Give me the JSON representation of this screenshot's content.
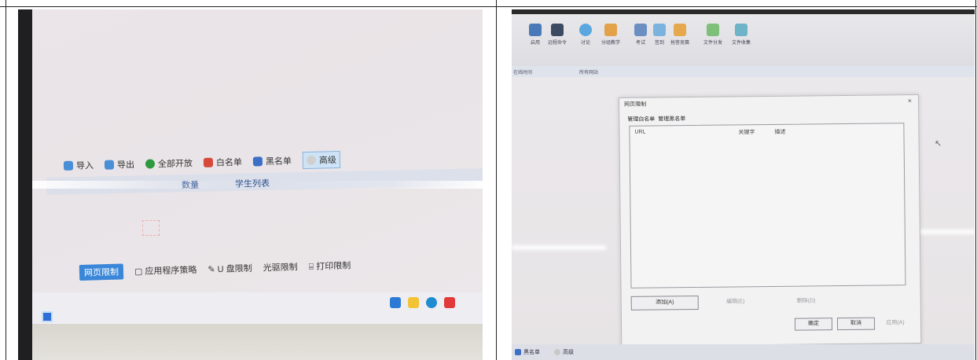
{
  "left": {
    "toolbar": [
      {
        "label": "导入",
        "icon": "import-icon",
        "color": "#4a8fd6"
      },
      {
        "label": "导出",
        "icon": "export-icon",
        "color": "#4a8fd6"
      },
      {
        "label": "全部开放",
        "icon": "open-all-icon",
        "color": "#2e9a3e"
      },
      {
        "label": "白名单",
        "icon": "whitelist-icon",
        "color": "#d6493a"
      },
      {
        "label": "黑名单",
        "icon": "blacklist-icon",
        "color": "#3d6fc6"
      },
      {
        "label": "高级",
        "icon": "advanced-icon",
        "color": "#888888"
      }
    ],
    "tabs": [
      "数量",
      "学生列表"
    ],
    "bottom_tabs": [
      "网页限制",
      "应用程序策略",
      "U 盘限制",
      "光驱限制",
      "打印限制"
    ],
    "accent": "#3a86d8"
  },
  "right": {
    "toolbar": [
      "启用",
      "远程命令",
      "讨论",
      "分组教学",
      "考试",
      "签到",
      "抢答竞赛",
      "文件分发",
      "文件收集"
    ],
    "subtabs": [
      "在线时间",
      "所有网站"
    ],
    "dialog": {
      "title": "网页限制",
      "close": "×",
      "tabs": [
        "管理白名单",
        "管理黑名单"
      ],
      "columns": [
        "URL",
        "关键字",
        "描述"
      ],
      "add": "添加(A)",
      "edit": "编辑(E)",
      "delete": "删除(D)",
      "ok": "确定",
      "cancel": "取消",
      "apply": "应用(A)"
    },
    "footer": [
      "黑名单",
      "高级"
    ]
  }
}
